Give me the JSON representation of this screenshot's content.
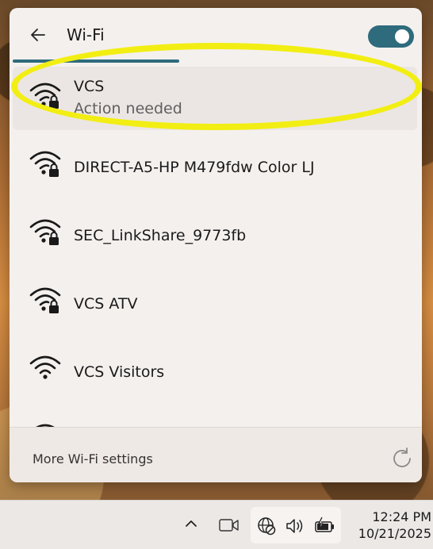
{
  "flyout": {
    "title": "Wi-Fi",
    "toggle_on": true,
    "accent_color": "#2e6b7c",
    "networks": [
      {
        "name": "VCS",
        "status": "Action needed",
        "secured": true,
        "icon": "wifi-lock-icon"
      },
      {
        "name": "DIRECT-A5-HP M479fdw Color LJ",
        "secured": true,
        "icon": "wifi-lock-icon"
      },
      {
        "name": "SEC_LinkShare_9773fb",
        "secured": true,
        "icon": "wifi-lock-icon"
      },
      {
        "name": "VCS ATV",
        "secured": true,
        "icon": "wifi-lock-icon"
      },
      {
        "name": "VCS Visitors",
        "secured": false,
        "icon": "wifi-icon"
      }
    ],
    "footer": {
      "more_label": "More Wi-Fi settings",
      "refresh_icon": "refresh-icon"
    }
  },
  "annotation": {
    "highlight_color": "#f2ee13"
  },
  "taskbar": {
    "time": "12:24 PM",
    "date": "10/21/2025",
    "icons": [
      "chevron-up-icon",
      "camera-icon",
      "globe-blocked-icon",
      "speaker-icon",
      "battery-charging-icon"
    ]
  }
}
